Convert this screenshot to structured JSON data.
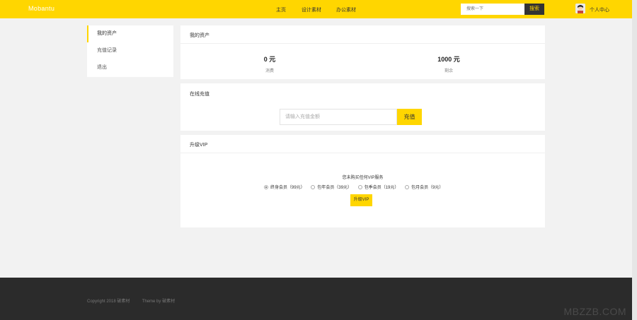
{
  "header": {
    "logo": "Mobantu",
    "nav": [
      "主页",
      "设计素材",
      "办公素材"
    ],
    "search_placeholder": "搜索一下",
    "search_button": "搜索",
    "user_center": "个人中心"
  },
  "sidebar": {
    "items": [
      {
        "label": "我的资产",
        "active": true
      },
      {
        "label": "充值记录",
        "active": false
      },
      {
        "label": "退出",
        "active": false
      }
    ]
  },
  "assets": {
    "title": "我的资产",
    "stats": [
      {
        "value": "0 元",
        "label": "消费"
      },
      {
        "value": "1000 元",
        "label": "剩余"
      }
    ]
  },
  "recharge": {
    "title": "在线充值",
    "amount_placeholder": "请输入充值金额",
    "button": "充值"
  },
  "vip": {
    "title": "升级VIP",
    "hint": "您未购买任何VIP服务",
    "options": [
      {
        "label": "终身会员（99元）",
        "checked": true
      },
      {
        "label": "包年会员（39元）",
        "checked": false
      },
      {
        "label": "包季会员（19元）",
        "checked": false
      },
      {
        "label": "包月会员（9元）",
        "checked": false
      }
    ],
    "button": "升级VIP"
  },
  "footer": {
    "copyright": "Copyright 2018 破素材",
    "theme": "Theme by 破素材",
    "watermark": "MBZZB.COM"
  },
  "colors": {
    "accent": "#ffd600",
    "footer_bg": "#2b2b2b",
    "page_bg": "#f2f2f2"
  }
}
